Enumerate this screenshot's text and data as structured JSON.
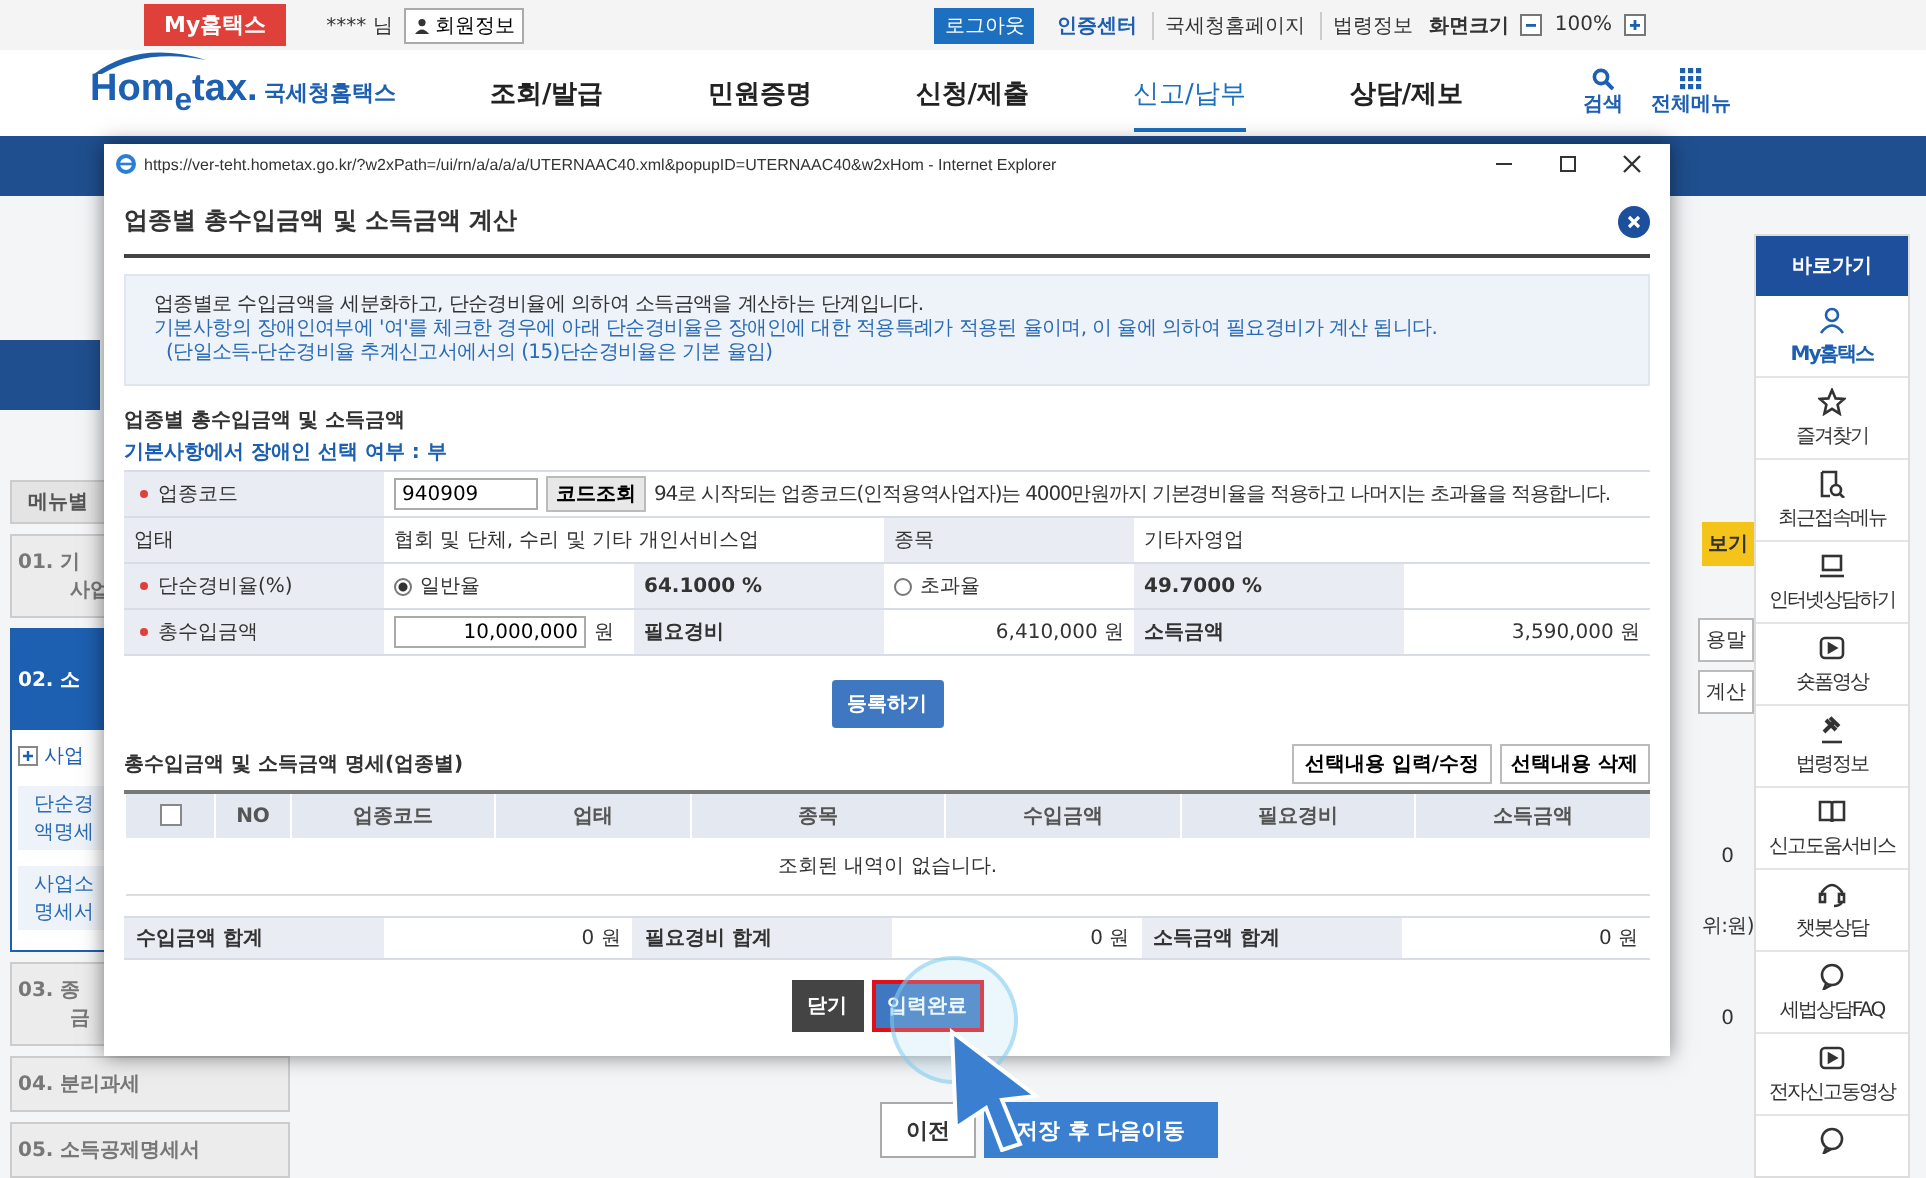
{
  "top_bar": {
    "brand": "My홈택스",
    "user": "**** 님",
    "member_info": "회원정보",
    "logout": "로그아웃",
    "links": [
      "인증센터",
      "국세청홈페이지",
      "법령정보"
    ],
    "zoom_label": "화면크기",
    "zoom_value": "100%"
  },
  "header": {
    "logo": "Hom$_{e}$tax.",
    "logo_sub": "국세청홈택스",
    "nav": [
      {
        "label": "조회/발급",
        "selected": false
      },
      {
        "label": "민원증명",
        "selected": false
      },
      {
        "label": "신청/제출",
        "selected": false
      },
      {
        "label": "신고/납부",
        "selected": true
      },
      {
        "label": "상담/제보",
        "selected": false
      }
    ],
    "search": "검색",
    "all_menu": "전체메뉴"
  },
  "left_menu": {
    "menu_button": "메뉴별",
    "steps": [
      {
        "lines": [
          "01. 기",
          "사업"
        ],
        "selected": false
      },
      {
        "lines": [
          "02. 소"
        ],
        "selected": true,
        "sub_title": "사업",
        "notes": [
          [
            "단순경",
            "액명세"
          ],
          [
            "사업소",
            "명세서"
          ]
        ]
      },
      {
        "lines": [
          "03. 종",
          "금"
        ],
        "selected": false
      },
      {
        "lines": [
          "04. 분리과세"
        ],
        "selected": false
      },
      {
        "lines": [
          "05. 소득공제명세서"
        ],
        "selected": false
      }
    ]
  },
  "behind": [
    {
      "text": "보기",
      "kind": "yellow"
    },
    {
      "text": "용말",
      "kind": "outline"
    },
    {
      "text": "계산",
      "kind": "outline"
    },
    {
      "text": "0",
      "kind": "cell"
    },
    {
      "text": "위:원)",
      "kind": "note"
    },
    {
      "text": "0",
      "kind": "cell"
    }
  ],
  "bottom_buttons": [
    {
      "label": "이전",
      "kind": "secondary"
    },
    {
      "label": "저장 후 다음이동",
      "kind": "primary"
    }
  ],
  "quick_bar": {
    "title": "바로가기",
    "items": [
      "My홈택스",
      "즐겨찾기",
      "최근접속메뉴",
      "인터넷상담하기",
      "숏폼영상",
      "법령정보",
      "신고도움서비스",
      "챗봇상담",
      "세법상담FAQ",
      "전자신고동영상"
    ]
  },
  "popup": {
    "url": "https://ver-teht.hometax.go.kr/?w2xPath=/ui/rn/a/a/a/a/UTERNAAC40.xml&popupID=UTERNAAC40&w2xHom - Internet Explorer",
    "title": "업종별 총수입금액 및 소득금액 계산",
    "notes": [
      {
        "text": "업종별로 수입금액을 세분화하고, 단순경비율에 의하여 소득금액을 계산하는 단계입니다.",
        "kind": "dark"
      },
      {
        "text": "기본사항의 장애인여부에 '여'를 체크한 경우에 아래 단순경비율은 장애인에 대한 적용특례가 적용된 율이며, 이 율에 의하여 필요경비가 계산 됩니다.",
        "kind": "blue"
      },
      {
        "text": "(단일소득-단순경비율 추계신고서에서의 (15)단순경비율은 기본 율임)",
        "kind": "blue_continued"
      }
    ],
    "section_title": "업종별 총수입금액 및 소득금액",
    "disability_notice": "기본사항에서 장애인 선택 여부 : 부",
    "code": {
      "label": "업종코드",
      "required": true,
      "value": "940909",
      "button": "코드조회",
      "hint": "94로 시작되는 업종코드(인적용역사업자)는 4000만원까지 기본경비율을 적용하고 나머지는 초과율을 적용합니다."
    },
    "business": {
      "label": "업태",
      "required": false,
      "value": "협회 및 단체, 수리 및 기타 개인서비스업",
      "item_label": "종목",
      "item_value": "기타자영업"
    },
    "rate": {
      "label": "단순경비율(%)",
      "required": true,
      "options": [
        {
          "label": "일반율",
          "value": "64.1000 %",
          "selected": true
        },
        {
          "label": "초과율",
          "value": "49.7000 %",
          "selected": false
        }
      ]
    },
    "revenue": {
      "label": "총수입금액",
      "required": true,
      "value": "10,000,000",
      "unit": "원",
      "expense_label": "필요경비",
      "expense_value": "6,410,000 원",
      "income_label": "소득금액",
      "income_value": "3,590,000 원"
    },
    "register_button": "등록하기",
    "detail_title": "총수입금액 및 소득금액 명세(업종별)",
    "detail_buttons": [
      "선택내용 입력/수정",
      "선택내용 삭제"
    ],
    "select_all_checked": false,
    "columns": [
      "NO",
      "업종코드",
      "업태",
      "종목",
      "수입금액",
      "필요경비",
      "소득금액"
    ],
    "empty_message": "조회된 내역이 없습니다.",
    "totals": [
      {
        "label": "수입금액 합계",
        "value": "0 원"
      },
      {
        "label": "필요경비 합계",
        "value": "0 원"
      },
      {
        "label": "소득금액 합계",
        "value": "0 원"
      }
    ],
    "footer_buttons": [
      {
        "label": "닫기",
        "kind": "dark",
        "highlighted": false
      },
      {
        "label": "입력완료",
        "kind": "primary",
        "highlighted": true
      }
    ]
  }
}
